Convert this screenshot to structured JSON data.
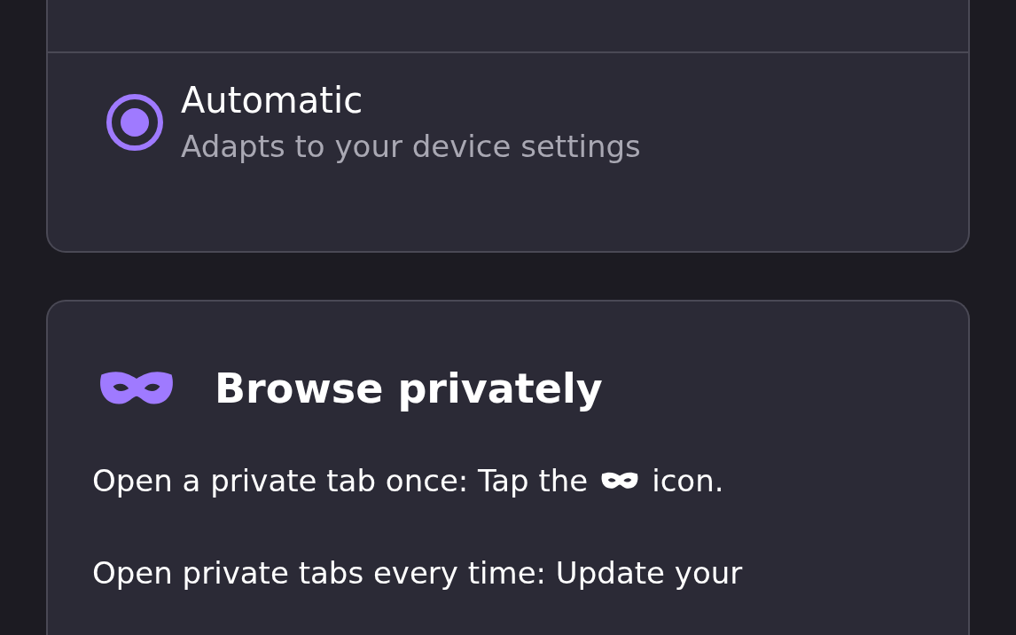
{
  "theme_card": {
    "options": [
      {
        "label": "Automatic",
        "description": "Adapts to your device settings",
        "selected": true
      }
    ]
  },
  "private_card": {
    "title": "Browse privately",
    "tip_before": "Open a private tab once: Tap the",
    "tip_after": "icon.",
    "tip2": "Open private tabs every time: Update your"
  }
}
